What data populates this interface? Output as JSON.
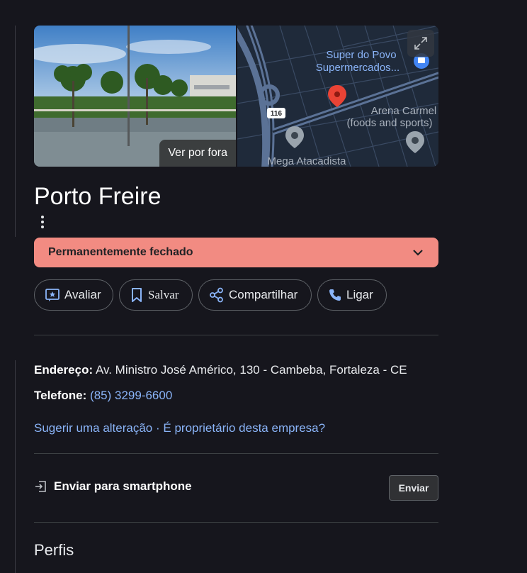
{
  "place": {
    "name": "Porto Freire",
    "status": "Permanentemente fechado"
  },
  "media": {
    "photo_label": "Ver por fora",
    "map_labels": {
      "poi1_line1": "Super do Povo",
      "poi1_line2": "Supermercados...",
      "poi2_line1": "Arena Carmel",
      "poi2_line2": "(foods and sports)",
      "poi3": "Mega Atacadista",
      "road_shield": "116"
    }
  },
  "actions": [
    {
      "label": "Avaliar",
      "icon": "review-star-icon"
    },
    {
      "label": "Salvar",
      "icon": "bookmark-icon"
    },
    {
      "label": "Compartilhar",
      "icon": "share-icon"
    },
    {
      "label": "Ligar",
      "icon": "phone-icon"
    }
  ],
  "details": {
    "address_label": "Endereço:",
    "address_value": "Av. Ministro José Américo, 130 - Cambeba, Fortaleza - CE",
    "phone_label": "Telefone:",
    "phone_value": "(85) 3299-6600",
    "suggest_edit": "Sugerir uma alteração",
    "separator": "·",
    "owner_link": "É proprietário desta empresa?"
  },
  "send": {
    "label": "Enviar para smartphone",
    "button": "Enviar"
  },
  "profiles_heading": "Perfis",
  "colors": {
    "background": "#16161d",
    "status_bg": "#f28b82",
    "link": "#8ab4f8",
    "map_pin": "#ea4335"
  }
}
